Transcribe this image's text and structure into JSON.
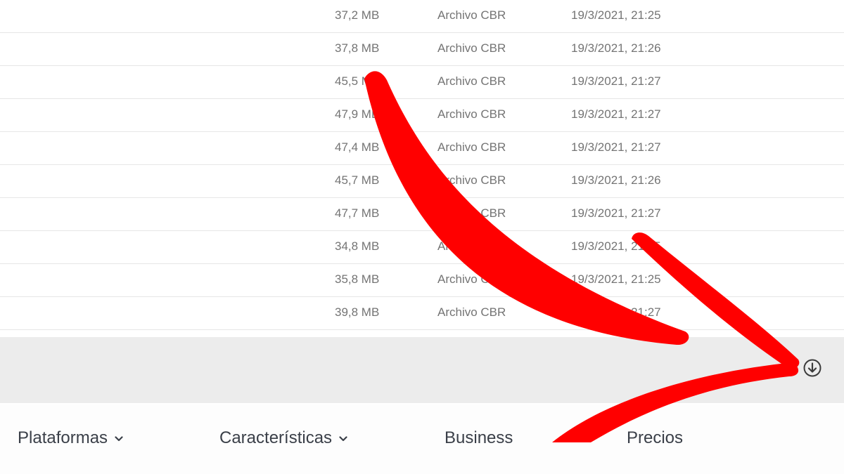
{
  "files": [
    {
      "size": "37,2 MB",
      "kind": "Archivo CBR",
      "date": "19/3/2021, 21:25"
    },
    {
      "size": "37,8 MB",
      "kind": "Archivo CBR",
      "date": "19/3/2021, 21:26"
    },
    {
      "size": "45,5 MB",
      "kind": "Archivo CBR",
      "date": "19/3/2021, 21:27"
    },
    {
      "size": "47,9 MB",
      "kind": "Archivo CBR",
      "date": "19/3/2021, 21:27"
    },
    {
      "size": "47,4 MB",
      "kind": "Archivo CBR",
      "date": "19/3/2021, 21:27"
    },
    {
      "size": "45,7 MB",
      "kind": "Archivo CBR",
      "date": "19/3/2021, 21:26"
    },
    {
      "size": "47,7 MB",
      "kind": "Archivo CBR",
      "date": "19/3/2021, 21:27"
    },
    {
      "size": "34,8 MB",
      "kind": "Archivo CBR",
      "date": "19/3/2021, 21:25"
    },
    {
      "size": "35,8 MB",
      "kind": "Archivo CBR",
      "date": "19/3/2021, 21:25"
    },
    {
      "size": "39,8 MB",
      "kind": "Archivo CBR",
      "date": "19/3/2021, 21:27"
    }
  ],
  "download_icon": "download-circle-icon",
  "nav": {
    "platforms": "Plataformas",
    "features": "Características",
    "business": "Business",
    "pricing": "Precios"
  },
  "annotation_color": "#ff0000"
}
